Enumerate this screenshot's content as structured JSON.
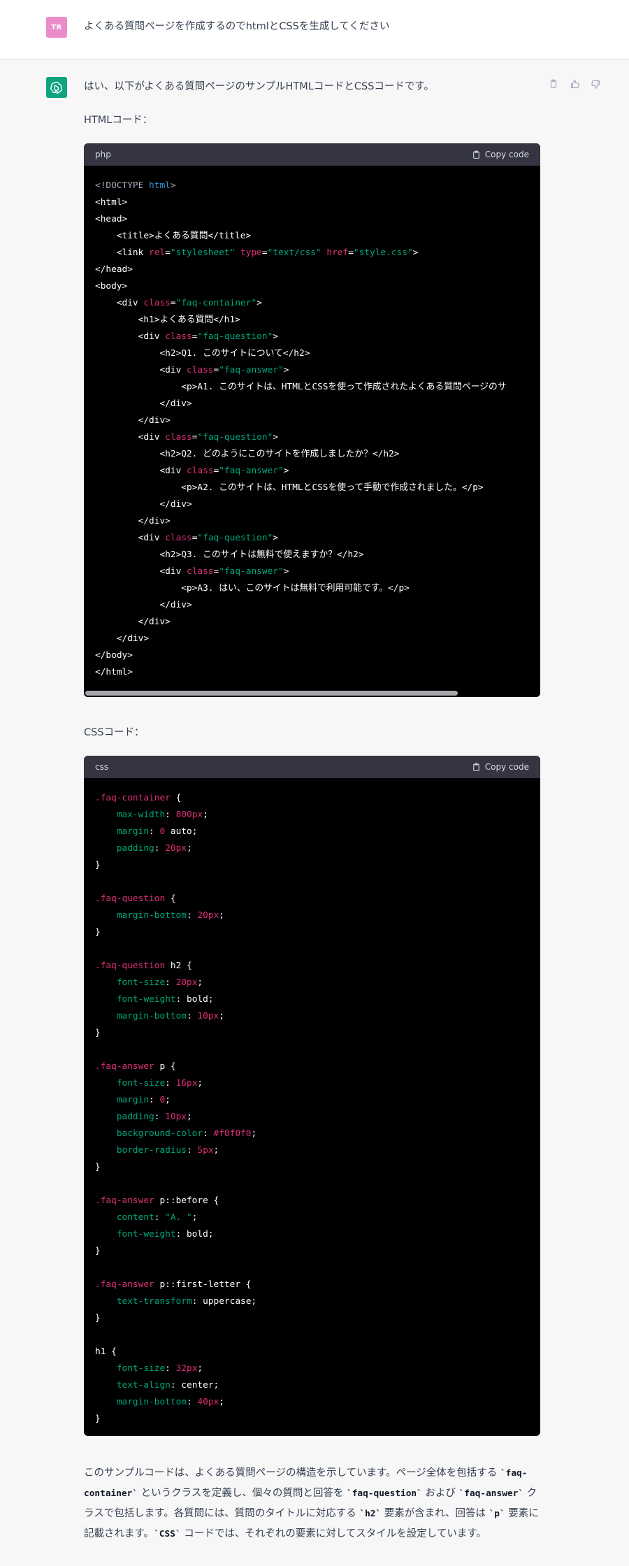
{
  "user": {
    "avatar_initials": "TR",
    "avatar_color": "#e98cc9",
    "message": "よくある質問ページを作成するのでhtmlとCSSを生成してください"
  },
  "assistant": {
    "avatar_color": "#10a37f",
    "intro": "はい、以下がよくある質問ページのサンプルHTMLコードとCSSコードです。",
    "html_label": "HTMLコード：",
    "css_label": "CSSコード：",
    "outro": {
      "p1": "このサンプルコードは、よくある質問ページの構造を示しています。ページ全体を包括する ",
      "c1": "`faq-container`",
      "p2": " というクラスを定義し、個々の質問と回答を ",
      "c2": "`faq-question`",
      "p3": " および ",
      "c3": "`faq-answer`",
      "p4": " クラスで包括します。各質問には、質問のタイトルに対応する ",
      "c4": "`h2`",
      "p5": " 要素が含まれ、回答は ",
      "c5": "`p`",
      "p6": " 要素に記載されます。",
      "c6": "`CSS`",
      "p7": " コードでは、それぞれの要素に対してスタイルを設定しています。"
    }
  },
  "icons": {
    "copy_feedback": "clipboard-icon",
    "thumb_up": "thumbs-up-icon",
    "thumb_down": "thumbs-down-icon",
    "bot_avatar": "openai-logo-icon"
  },
  "html_code": {
    "language": "php",
    "copy_label": "Copy code",
    "lines": [
      [
        [
          "doc",
          "<!DOCTYPE "
        ],
        [
          "kw",
          "html"
        ],
        [
          "doc",
          ">"
        ]
      ],
      [
        [
          "tag",
          "<html>"
        ]
      ],
      [
        [
          "tag",
          "<head>"
        ]
      ],
      [
        [
          "tag",
          "    <title>よくある質問</title>"
        ]
      ],
      [
        [
          "tag",
          "    <link "
        ],
        [
          "attr",
          "rel"
        ],
        [
          "tag",
          "="
        ],
        [
          "str",
          "\"stylesheet\""
        ],
        [
          "tag",
          " "
        ],
        [
          "attr",
          "type"
        ],
        [
          "tag",
          "="
        ],
        [
          "str",
          "\"text/css\""
        ],
        [
          "tag",
          " "
        ],
        [
          "attr",
          "href"
        ],
        [
          "tag",
          "="
        ],
        [
          "str",
          "\"style.css\""
        ],
        [
          "tag",
          ">"
        ]
      ],
      [
        [
          "tag",
          "</head>"
        ]
      ],
      [
        [
          "tag",
          "<body>"
        ]
      ],
      [
        [
          "tag",
          "    <div "
        ],
        [
          "attr",
          "class"
        ],
        [
          "tag",
          "="
        ],
        [
          "str",
          "\"faq-container\""
        ],
        [
          "tag",
          ">"
        ]
      ],
      [
        [
          "tag",
          "        <h1>よくある質問</h1>"
        ]
      ],
      [
        [
          "tag",
          "        <div "
        ],
        [
          "attr",
          "class"
        ],
        [
          "tag",
          "="
        ],
        [
          "str",
          "\"faq-question\""
        ],
        [
          "tag",
          ">"
        ]
      ],
      [
        [
          "tag",
          "            <h2>Q1. このサイトについて</h2>"
        ]
      ],
      [
        [
          "tag",
          "            <div "
        ],
        [
          "attr",
          "class"
        ],
        [
          "tag",
          "="
        ],
        [
          "str",
          "\"faq-answer\""
        ],
        [
          "tag",
          ">"
        ]
      ],
      [
        [
          "tag",
          "                <p>A1. このサイトは、HTMLとCSSを使って作成されたよくある質問ページのサ"
        ]
      ],
      [
        [
          "tag",
          "            </div>"
        ]
      ],
      [
        [
          "tag",
          "        </div>"
        ]
      ],
      [
        [
          "tag",
          "        <div "
        ],
        [
          "attr",
          "class"
        ],
        [
          "tag",
          "="
        ],
        [
          "str",
          "\"faq-question\""
        ],
        [
          "tag",
          ">"
        ]
      ],
      [
        [
          "tag",
          "            <h2>Q2. どのようにこのサイトを作成しましたか？</h2>"
        ]
      ],
      [
        [
          "tag",
          "            <div "
        ],
        [
          "attr",
          "class"
        ],
        [
          "tag",
          "="
        ],
        [
          "str",
          "\"faq-answer\""
        ],
        [
          "tag",
          ">"
        ]
      ],
      [
        [
          "tag",
          "                <p>A2. このサイトは、HTMLとCSSを使って手動で作成されました。</p>"
        ]
      ],
      [
        [
          "tag",
          "            </div>"
        ]
      ],
      [
        [
          "tag",
          "        </div>"
        ]
      ],
      [
        [
          "tag",
          "        <div "
        ],
        [
          "attr",
          "class"
        ],
        [
          "tag",
          "="
        ],
        [
          "str",
          "\"faq-question\""
        ],
        [
          "tag",
          ">"
        ]
      ],
      [
        [
          "tag",
          "            <h2>Q3. このサイトは無料で使えますか？</h2>"
        ]
      ],
      [
        [
          "tag",
          "            <div "
        ],
        [
          "attr",
          "class"
        ],
        [
          "tag",
          "="
        ],
        [
          "str",
          "\"faq-answer\""
        ],
        [
          "tag",
          ">"
        ]
      ],
      [
        [
          "tag",
          "                <p>A3. はい、このサイトは無料で利用可能です。</p>"
        ]
      ],
      [
        [
          "tag",
          "            </div>"
        ]
      ],
      [
        [
          "tag",
          "        </div>"
        ]
      ],
      [
        [
          "tag",
          "    </div>"
        ]
      ],
      [
        [
          "tag",
          "</body>"
        ]
      ],
      [
        [
          "tag",
          "</html>"
        ]
      ]
    ]
  },
  "css_code": {
    "language": "css",
    "copy_label": "Copy code",
    "lines": [
      [
        [
          "sel",
          ".faq-container"
        ],
        [
          "plain",
          " {"
        ]
      ],
      [
        [
          "prop",
          "    max-width"
        ],
        [
          "plain",
          ": "
        ],
        [
          "num",
          "800px"
        ],
        [
          "plain",
          ";"
        ]
      ],
      [
        [
          "prop",
          "    margin"
        ],
        [
          "plain",
          ": "
        ],
        [
          "num",
          "0"
        ],
        [
          "plain",
          " auto;"
        ]
      ],
      [
        [
          "prop",
          "    padding"
        ],
        [
          "plain",
          ": "
        ],
        [
          "num",
          "20px"
        ],
        [
          "plain",
          ";"
        ]
      ],
      [
        [
          "plain",
          "}"
        ]
      ],
      [
        [
          "plain",
          ""
        ]
      ],
      [
        [
          "sel",
          ".faq-question"
        ],
        [
          "plain",
          " {"
        ]
      ],
      [
        [
          "prop",
          "    margin-bottom"
        ],
        [
          "plain",
          ": "
        ],
        [
          "num",
          "20px"
        ],
        [
          "plain",
          ";"
        ]
      ],
      [
        [
          "plain",
          "}"
        ]
      ],
      [
        [
          "plain",
          ""
        ]
      ],
      [
        [
          "sel",
          ".faq-question"
        ],
        [
          "plain",
          " h2 {"
        ]
      ],
      [
        [
          "prop",
          "    font-size"
        ],
        [
          "plain",
          ": "
        ],
        [
          "num",
          "20px"
        ],
        [
          "plain",
          ";"
        ]
      ],
      [
        [
          "prop",
          "    font-weight"
        ],
        [
          "plain",
          ": bold;"
        ]
      ],
      [
        [
          "prop",
          "    margin-bottom"
        ],
        [
          "plain",
          ": "
        ],
        [
          "num",
          "10px"
        ],
        [
          "plain",
          ";"
        ]
      ],
      [
        [
          "plain",
          "}"
        ]
      ],
      [
        [
          "plain",
          ""
        ]
      ],
      [
        [
          "sel",
          ".faq-answer"
        ],
        [
          "plain",
          " p {"
        ]
      ],
      [
        [
          "prop",
          "    font-size"
        ],
        [
          "plain",
          ": "
        ],
        [
          "num",
          "16px"
        ],
        [
          "plain",
          ";"
        ]
      ],
      [
        [
          "prop",
          "    margin"
        ],
        [
          "plain",
          ": "
        ],
        [
          "num",
          "0"
        ],
        [
          "plain",
          ";"
        ]
      ],
      [
        [
          "prop",
          "    padding"
        ],
        [
          "plain",
          ": "
        ],
        [
          "num",
          "10px"
        ],
        [
          "plain",
          ";"
        ]
      ],
      [
        [
          "prop",
          "    background-color"
        ],
        [
          "plain",
          ": "
        ],
        [
          "num",
          "#f0f0f0"
        ],
        [
          "plain",
          ";"
        ]
      ],
      [
        [
          "prop",
          "    border-radius"
        ],
        [
          "plain",
          ": "
        ],
        [
          "num",
          "5px"
        ],
        [
          "plain",
          ";"
        ]
      ],
      [
        [
          "plain",
          "}"
        ]
      ],
      [
        [
          "plain",
          ""
        ]
      ],
      [
        [
          "sel",
          ".faq-answer"
        ],
        [
          "plain",
          " p::before {"
        ]
      ],
      [
        [
          "prop",
          "    content"
        ],
        [
          "plain",
          ": "
        ],
        [
          "str",
          "\"A. \""
        ],
        [
          "plain",
          ";"
        ]
      ],
      [
        [
          "prop",
          "    font-weight"
        ],
        [
          "plain",
          ": bold;"
        ]
      ],
      [
        [
          "plain",
          "}"
        ]
      ],
      [
        [
          "plain",
          ""
        ]
      ],
      [
        [
          "sel",
          ".faq-answer"
        ],
        [
          "plain",
          " p::first-letter {"
        ]
      ],
      [
        [
          "prop",
          "    text-transform"
        ],
        [
          "plain",
          ": uppercase;"
        ]
      ],
      [
        [
          "plain",
          "}"
        ]
      ],
      [
        [
          "plain",
          ""
        ]
      ],
      [
        [
          "plain",
          "h1 {"
        ]
      ],
      [
        [
          "prop",
          "    font-size"
        ],
        [
          "plain",
          ": "
        ],
        [
          "num",
          "32px"
        ],
        [
          "plain",
          ";"
        ]
      ],
      [
        [
          "prop",
          "    text-align"
        ],
        [
          "plain",
          ": center;"
        ]
      ],
      [
        [
          "prop",
          "    margin-bottom"
        ],
        [
          "plain",
          ": "
        ],
        [
          "num",
          "40px"
        ],
        [
          "plain",
          ";"
        ]
      ],
      [
        [
          "plain",
          "}"
        ]
      ]
    ]
  }
}
